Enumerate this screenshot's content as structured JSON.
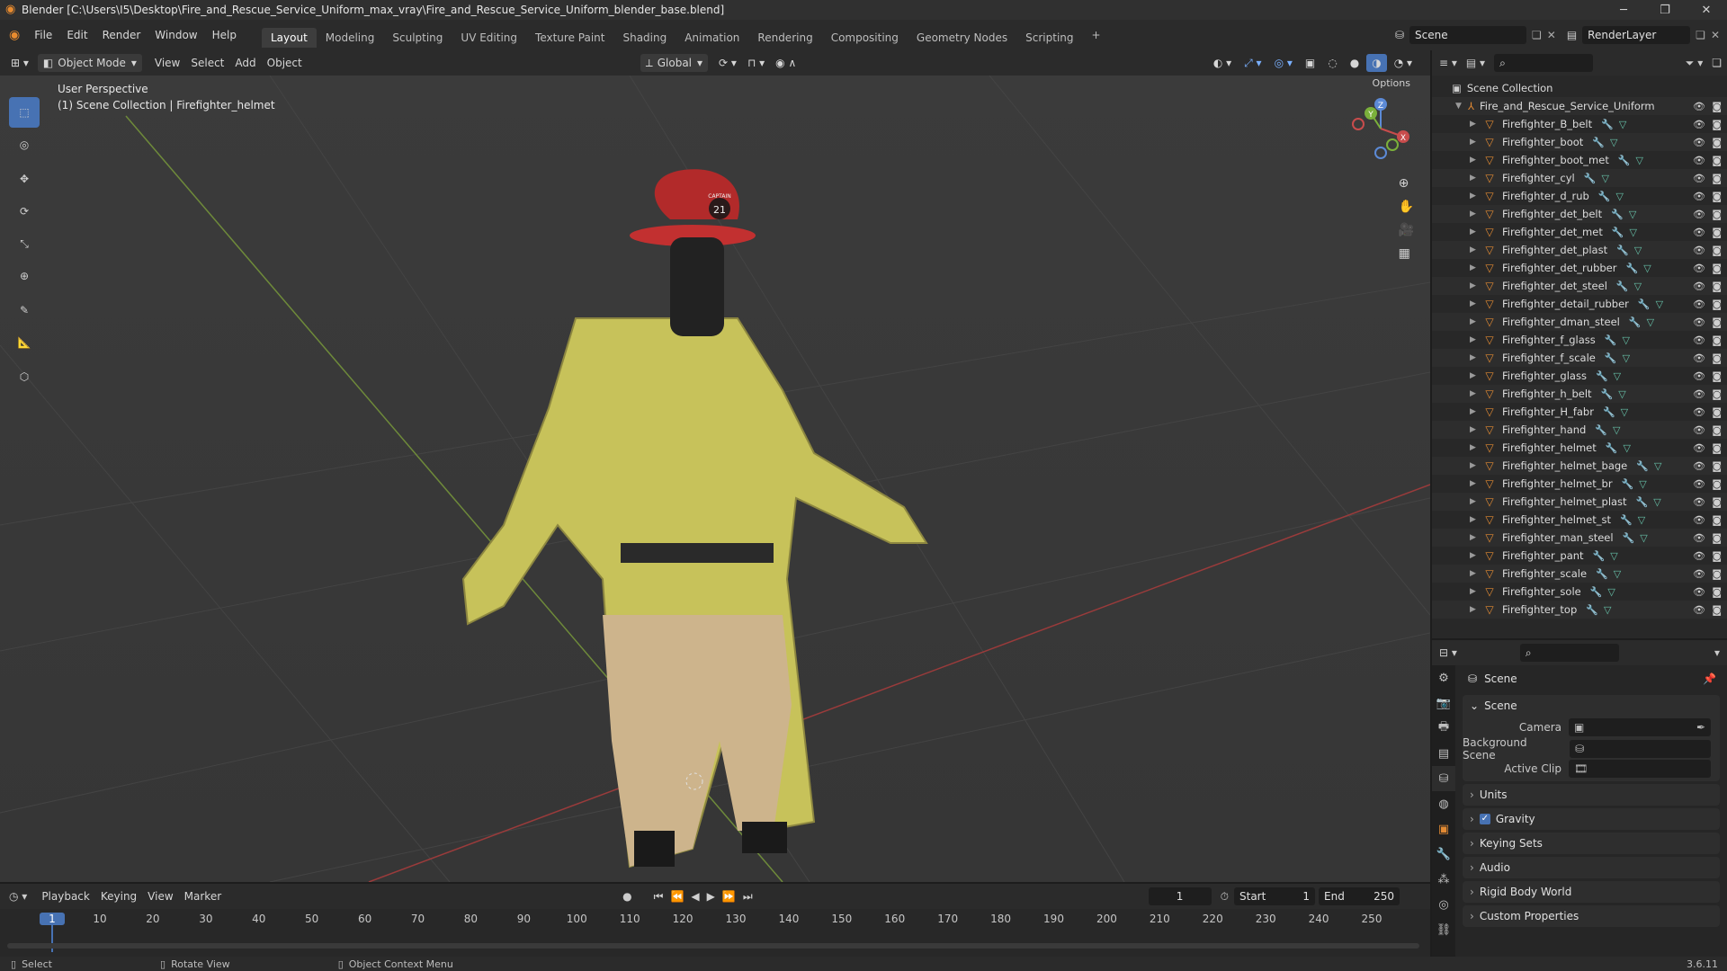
{
  "titlebar": {
    "title": "Blender [C:\\Users\\I5\\Desktop\\Fire_and_Rescue_Service_Uniform_max_vray\\Fire_and_Rescue_Service_Uniform_blender_base.blend]",
    "minimize": "─",
    "maximize": "❐",
    "close": "✕"
  },
  "menu": [
    "File",
    "Edit",
    "Render",
    "Window",
    "Help"
  ],
  "workspaces": [
    "Layout",
    "Modeling",
    "Sculpting",
    "UV Editing",
    "Texture Paint",
    "Shading",
    "Animation",
    "Rendering",
    "Compositing",
    "Geometry Nodes",
    "Scripting"
  ],
  "add_workspace": "+",
  "scene_name": "Scene",
  "render_layer": "RenderLayer",
  "viewport_header": {
    "mode": "Object Mode",
    "menus": [
      "View",
      "Select",
      "Add",
      "Object"
    ],
    "orientation": "Global",
    "options": "Options"
  },
  "viewport": {
    "perspective": "User Perspective",
    "collection_info": "(1) Scene Collection | Firefighter_helmet",
    "helmet_number": "21",
    "helmet_text": "CAPTAIN"
  },
  "gizmo": {
    "z": "Z",
    "y": "Y",
    "x": "X"
  },
  "outliner": {
    "root": "Scene Collection",
    "collection": "Fire_and_Rescue_Service_Uniform",
    "objects": [
      "Firefighter_B_belt",
      "Firefighter_boot",
      "Firefighter_boot_met",
      "Firefighter_cyl",
      "Firefighter_d_rub",
      "Firefighter_det_belt",
      "Firefighter_det_met",
      "Firefighter_det_plast",
      "Firefighter_det_rubber",
      "Firefighter_det_steel",
      "Firefighter_detail_rubber",
      "Firefighter_dman_steel",
      "Firefighter_f_glass",
      "Firefighter_f_scale",
      "Firefighter_glass",
      "Firefighter_h_belt",
      "Firefighter_H_fabr",
      "Firefighter_hand",
      "Firefighter_helmet",
      "Firefighter_helmet_bage",
      "Firefighter_helmet_br",
      "Firefighter_helmet_plast",
      "Firefighter_helmet_st",
      "Firefighter_man_steel",
      "Firefighter_pant",
      "Firefighter_scale",
      "Firefighter_sole",
      "Firefighter_top"
    ]
  },
  "properties": {
    "context": "Scene",
    "panel_scene": "Scene",
    "camera_label": "Camera",
    "background_label": "Background Scene",
    "clip_label": "Active Clip",
    "sections": [
      "Units",
      "Gravity",
      "Keying Sets",
      "Audio",
      "Rigid Body World",
      "Custom Properties"
    ]
  },
  "timeline": {
    "menus": [
      "Playback",
      "Keying",
      "View",
      "Marker"
    ],
    "current_frame": "1",
    "start_label": "Start",
    "start": "1",
    "end_label": "End",
    "end": "250",
    "ticks": [
      "1",
      "10",
      "20",
      "30",
      "40",
      "50",
      "60",
      "70",
      "80",
      "90",
      "100",
      "110",
      "120",
      "130",
      "140",
      "150",
      "160",
      "170",
      "180",
      "190",
      "200",
      "210",
      "220",
      "230",
      "240",
      "250"
    ]
  },
  "status": {
    "select": "Select",
    "rotate": "Rotate View",
    "context_menu": "Object Context Menu",
    "version": "3.6.11"
  }
}
